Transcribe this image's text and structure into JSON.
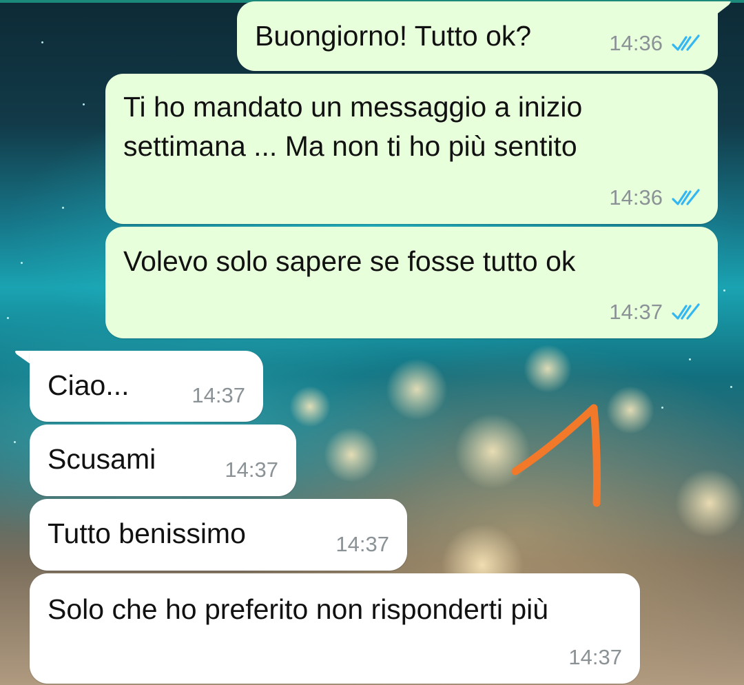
{
  "messages": [
    {
      "direction": "outgoing",
      "text": "Buongiorno! Tutto ok?",
      "time": "14:36",
      "status": "read"
    },
    {
      "direction": "outgoing",
      "text": "Ti ho mandato un messaggio a inizio settimana ... Ma non ti ho più sentito",
      "time": "14:36",
      "status": "read"
    },
    {
      "direction": "outgoing",
      "text": "Volevo solo sapere se fosse tutto ok",
      "time": "14:37",
      "status": "read"
    },
    {
      "direction": "incoming",
      "text": "Ciao...",
      "time": "14:37"
    },
    {
      "direction": "incoming",
      "text": "Scusami",
      "time": "14:37"
    },
    {
      "direction": "incoming",
      "text": "Tutto benissimo",
      "time": "14:37"
    },
    {
      "direction": "incoming",
      "text": "Solo che ho preferito non risponderti più",
      "time": "14:37"
    }
  ],
  "colors": {
    "outgoing_bubble": "#e7ffdb",
    "incoming_bubble": "#ffffff",
    "read_ticks": "#34b7f1",
    "timestamp": "#8b9296",
    "annotation_stroke": "#f2782a"
  },
  "icons": {
    "read_status": "double-check-icon"
  },
  "annotation": {
    "shape": "hand-drawn-arrow",
    "color": "#f2782a"
  }
}
